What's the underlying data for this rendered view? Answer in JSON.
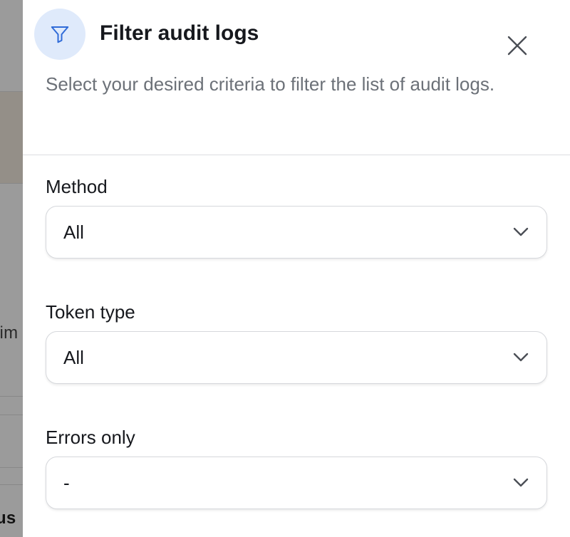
{
  "background": {
    "partial_text_mid": "lim",
    "partial_text_bottom": "us"
  },
  "drawer": {
    "title": "Filter audit logs",
    "description": "Select your desired criteria to filter the list of audit logs.",
    "header_icon": "filter-icon",
    "close_icon": "close-icon",
    "accent_color": "#2f6bd8"
  },
  "filters": [
    {
      "label": "Method",
      "value": "All"
    },
    {
      "label": "Token type",
      "value": "All"
    },
    {
      "label": "Errors only",
      "value": "-"
    }
  ]
}
